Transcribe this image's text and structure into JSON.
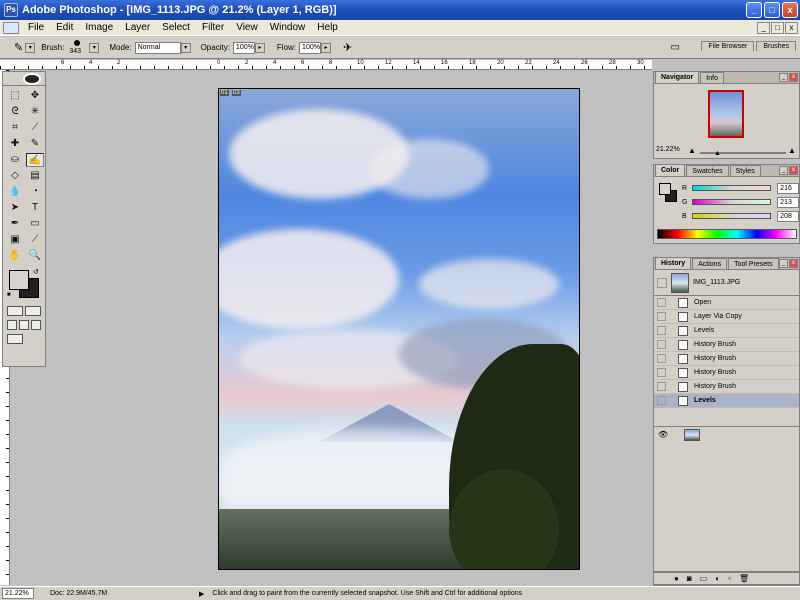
{
  "window": {
    "title": "Adobe Photoshop - [IMG_1113.JPG @ 21.2% (Layer 1, RGB)]",
    "min": "_",
    "max": "□",
    "close": "x"
  },
  "menu": {
    "items": [
      "File",
      "Edit",
      "Image",
      "Layer",
      "Select",
      "Filter",
      "View",
      "Window",
      "Help"
    ]
  },
  "options": {
    "brush_label": "Brush:",
    "brush_size": "343",
    "mode_label": "Mode:",
    "mode_value": "Normal",
    "opacity_label": "Opacity:",
    "opacity_value": "100%",
    "flow_label": "Flow:",
    "flow_value": "100%",
    "tabs": [
      "File Browser",
      "Brushes"
    ]
  },
  "ruler": {
    "ticks": [
      "6",
      "4",
      "2",
      "0",
      "2",
      "4",
      "6",
      "8",
      "10",
      "12",
      "14",
      "16",
      "18",
      "20",
      "22",
      "24",
      "26",
      "28",
      "30"
    ]
  },
  "document": {
    "badge1": "01",
    "badge2": "03"
  },
  "status": {
    "zoom": "21.22%",
    "doc": "Doc: 22.9M/45.7M",
    "hint": "Click and drag to paint from the currently selected snapshot.  Use Shift and Ctrl for additional options"
  },
  "navigator": {
    "tabs": [
      "Navigator",
      "Info"
    ],
    "zoom": "21.22%"
  },
  "color": {
    "tabs": [
      "Color",
      "Swatches",
      "Styles"
    ],
    "channels": [
      {
        "label": "R",
        "value": "216",
        "grad": "#10d8d0"
      },
      {
        "label": "G",
        "value": "213",
        "grad": "#d810d0"
      },
      {
        "label": "B",
        "value": "208",
        "grad": "#d8d010"
      }
    ]
  },
  "history": {
    "tabs": [
      "History",
      "Actions",
      "Tool Presets"
    ],
    "snapshot": "IMG_1113.JPG",
    "states": [
      "Open",
      "Layer Via Copy",
      "Levels",
      "History Brush",
      "History Brush",
      "History Brush",
      "History Brush",
      "Levels"
    ],
    "active_index": 7
  }
}
